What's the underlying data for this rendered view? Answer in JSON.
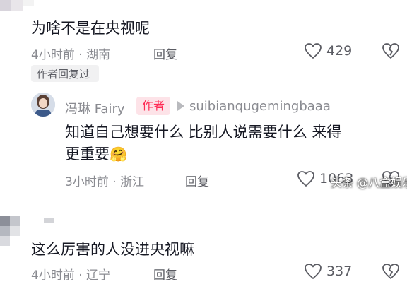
{
  "comment1": {
    "text": "为啥不是在央视呢",
    "time": "4小时前",
    "location": "湖南",
    "reply_label": "回复",
    "likes": "429",
    "author_replied_tag": "作者回复过"
  },
  "reply": {
    "nickname": "冯琳 Fairy",
    "author_badge": "作者",
    "reply_to": "suibianqugemingbaaa",
    "text_line1": "知道自己想要什么 比别人说需要什么 来得",
    "text_line2": "更重要",
    "emoji": "🤗",
    "time": "3小时前",
    "location": "浙江",
    "reply_label": "回复",
    "likes": "1063"
  },
  "comment2": {
    "text": "这么厉害的人没进央视嘛",
    "time": "4小时前",
    "location": "辽宁",
    "reply_label": "回复",
    "likes": "337"
  },
  "watermark": "头条 @八盒娱乐",
  "meta_separator": " · ",
  "icons": [
    "heart-outline-icon",
    "broken-heart-icon",
    "reply-arrow-icon"
  ],
  "colors": {
    "text": "#161823",
    "muted": "#8a8b91",
    "author_badge_bg": "#fde3e8",
    "author_badge_text": "#fe2c55"
  }
}
